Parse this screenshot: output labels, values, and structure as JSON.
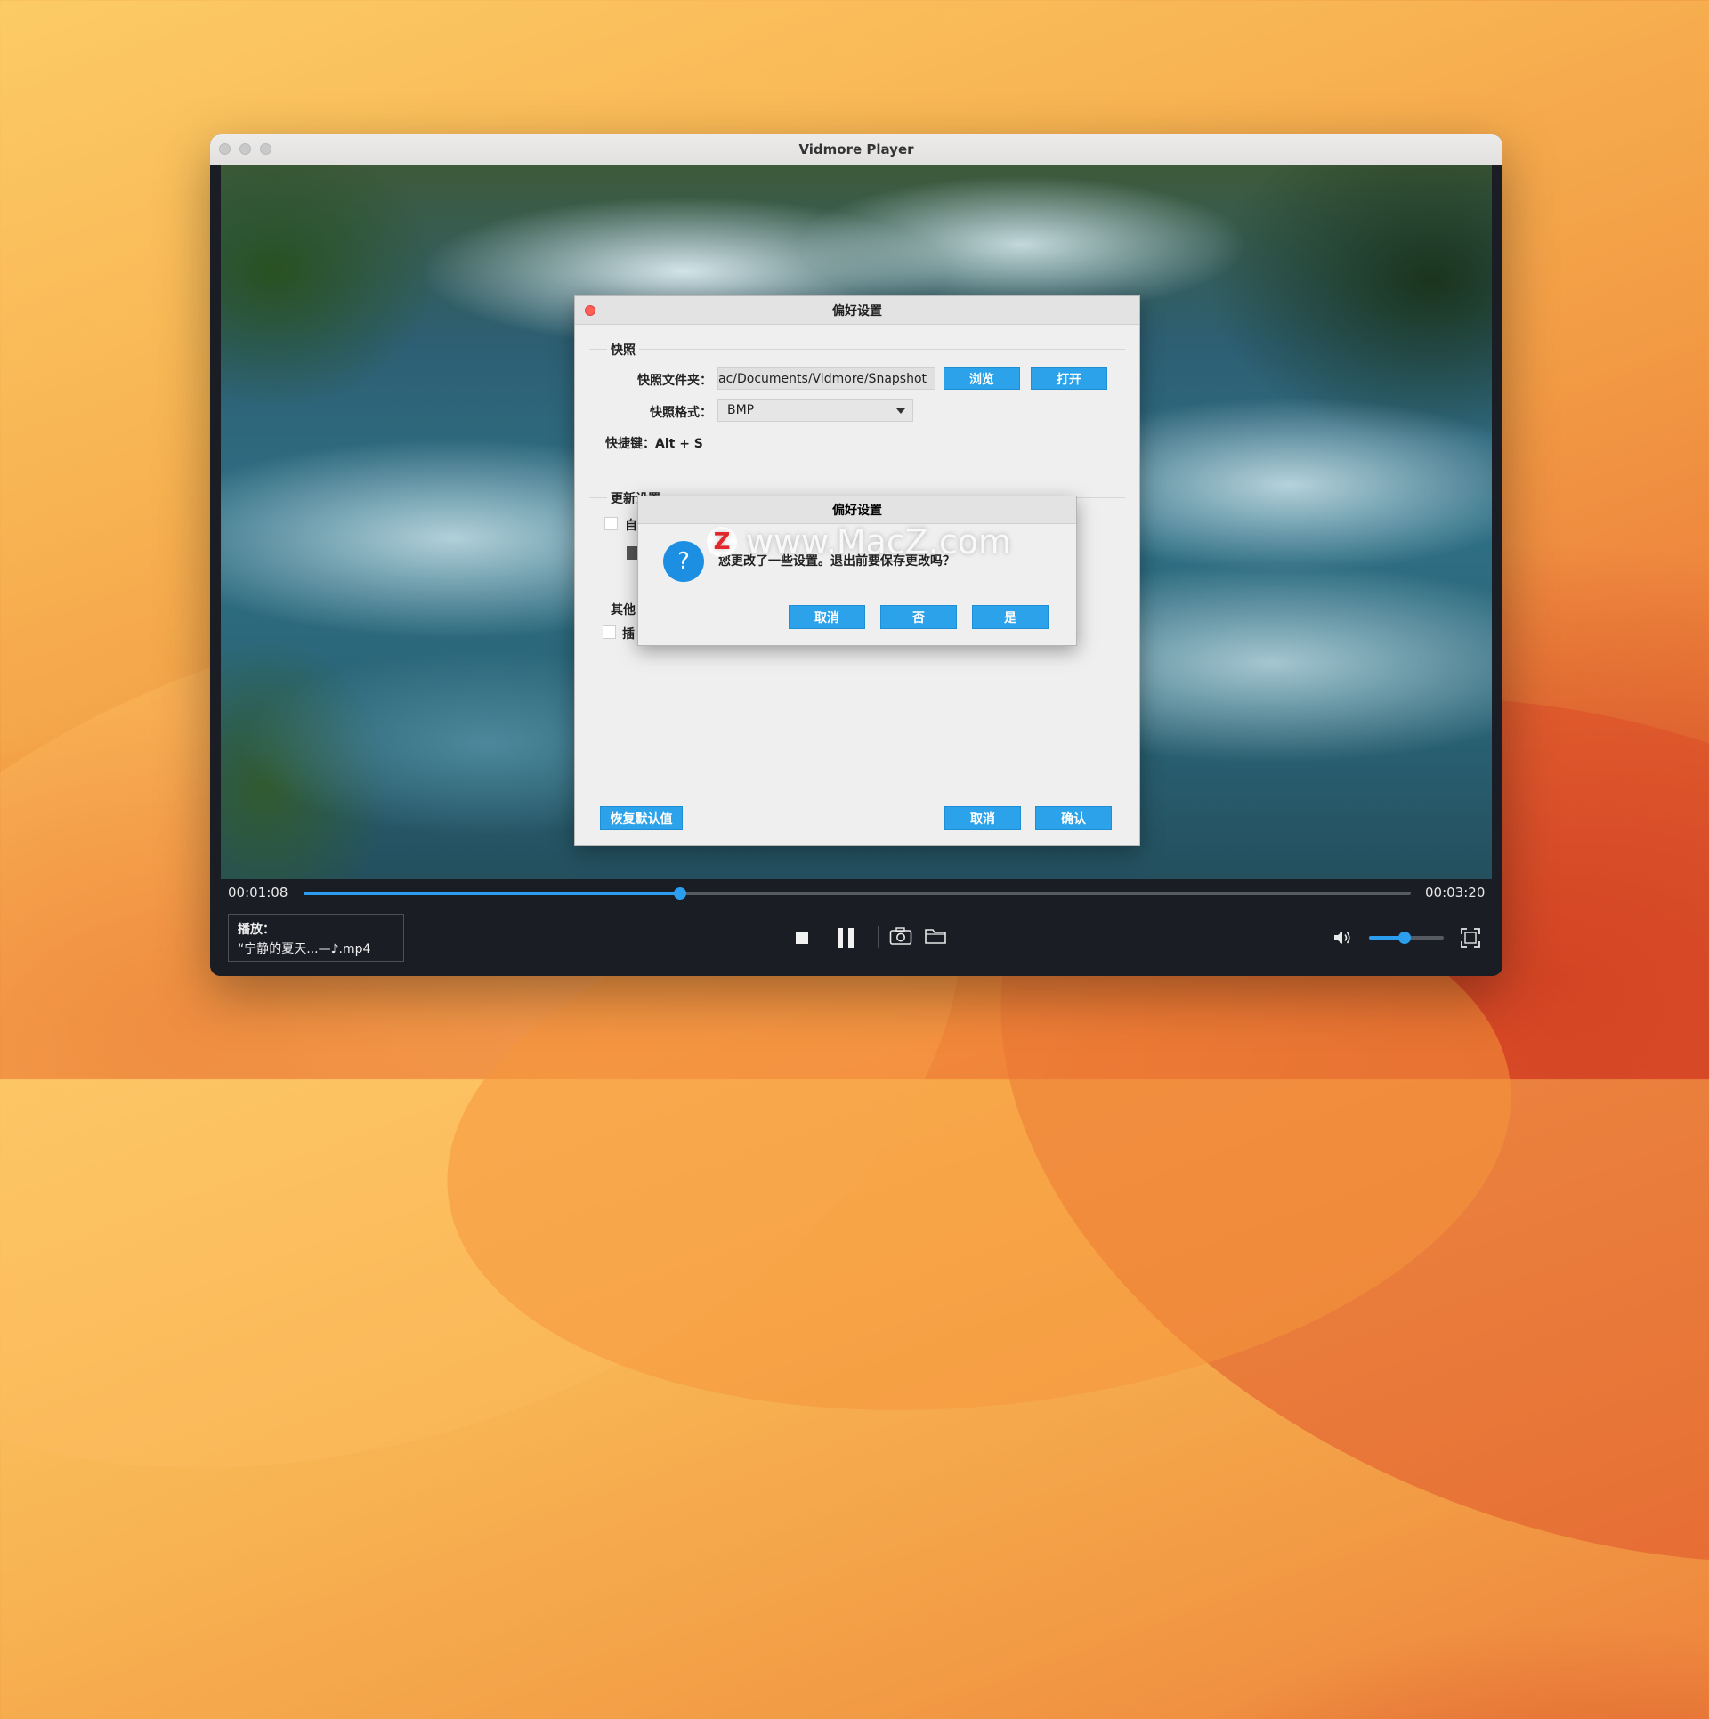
{
  "window": {
    "title": "Vidmore Player"
  },
  "player": {
    "current_time": "00:01:08",
    "total_time": "00:03:20",
    "progress_pct": 34,
    "volume_pct": 48,
    "now_playing_label": "播放：",
    "now_playing_file": "“宁静的夏天...—♪.mp4"
  },
  "prefs": {
    "title": "偏好设置",
    "snapshot": {
      "section_label": "快照",
      "folder_label": "快照文件夹：",
      "folder_value": "ac/Documents/Vidmore/Snapshot",
      "browse_label": "浏览",
      "open_label": "打开",
      "format_label": "快照格式：",
      "format_value": "BMP",
      "hotkey_text": "快捷键：Alt + S"
    },
    "update": {
      "section_label": "更新设置",
      "item1_text": "自"
    },
    "other": {
      "section_label": "其他",
      "item1_text": "插"
    },
    "restore_label": "恢复默认值",
    "cancel_label": "取消",
    "confirm_label": "确认"
  },
  "confirm": {
    "title": "偏好设置",
    "message": "您更改了一些设置。退出前要保存更改吗？",
    "cancel_label": "取消",
    "no_label": "否",
    "yes_label": "是"
  },
  "watermark": {
    "text": "www.MacZ.com",
    "logo_letter": "Z"
  },
  "colors": {
    "accent": "#2ba2ea",
    "progress": "#2c9ef0",
    "close": "#fe5f57"
  }
}
